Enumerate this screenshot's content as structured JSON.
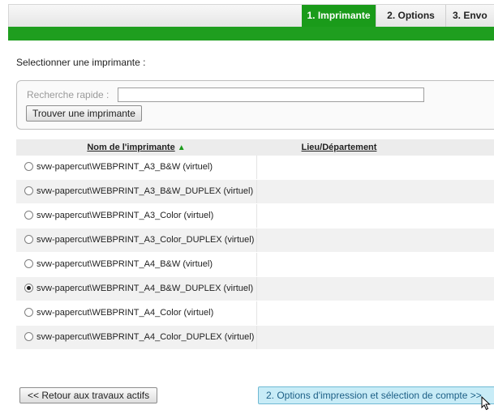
{
  "steps": [
    {
      "label": "1. Imprimante",
      "active": true
    },
    {
      "label": "2. Options",
      "active": false
    },
    {
      "label": "3. Envo",
      "active": false
    }
  ],
  "select_label": "Selectionner une imprimante :",
  "search": {
    "label": "Recherche rapide :",
    "value": "",
    "button_label": "Trouver une imprimante"
  },
  "table": {
    "headers": {
      "name": "Nom de l'imprimante",
      "location": "Lieu/Département"
    },
    "sort_icon": "triangle-up-icon",
    "rows": [
      {
        "name": "svw-papercut\\WEBPRINT_A3_B&W (virtuel)",
        "location": "",
        "selected": false
      },
      {
        "name": "svw-papercut\\WEBPRINT_A3_B&W_DUPLEX (virtuel)",
        "location": "",
        "selected": false
      },
      {
        "name": "svw-papercut\\WEBPRINT_A3_Color (virtuel)",
        "location": "",
        "selected": false
      },
      {
        "name": "svw-papercut\\WEBPRINT_A3_Color_DUPLEX (virtuel)",
        "location": "",
        "selected": false
      },
      {
        "name": "svw-papercut\\WEBPRINT_A4_B&W (virtuel)",
        "location": "",
        "selected": false
      },
      {
        "name": "svw-papercut\\WEBPRINT_A4_B&W_DUPLEX (virtuel)",
        "location": "",
        "selected": true
      },
      {
        "name": "svw-papercut\\WEBPRINT_A4_Color (virtuel)",
        "location": "",
        "selected": false
      },
      {
        "name": "svw-papercut\\WEBPRINT_A4_Color_DUPLEX (virtuel)",
        "location": "",
        "selected": false
      }
    ]
  },
  "buttons": {
    "back_label": "<< Retour aux travaux actifs",
    "next_label": "2. Options d'impression et sélection de compte >>"
  },
  "colors": {
    "accent_green": "#1a9b1a",
    "next_button_bg": "#c8ecf7"
  }
}
